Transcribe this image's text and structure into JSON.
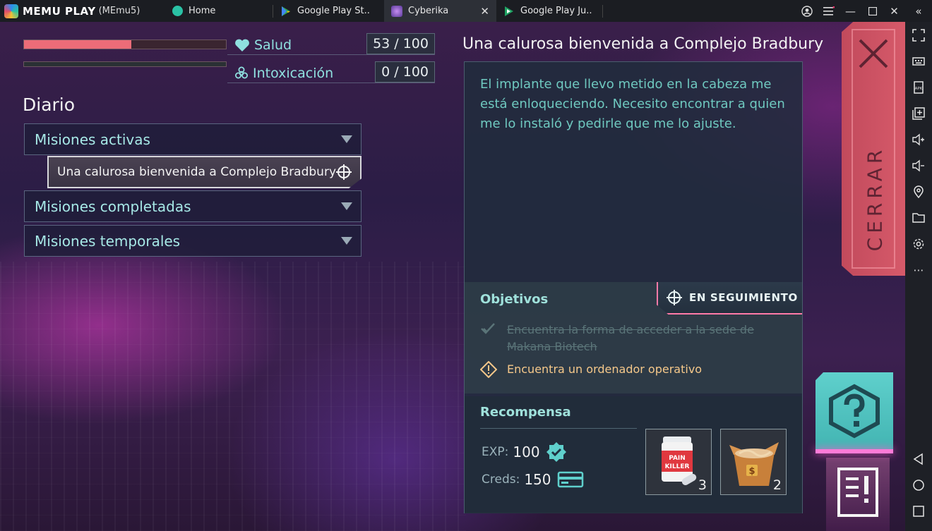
{
  "emulator": {
    "brand": "MEMU PLAY",
    "instance": "(MEmu5)",
    "tabs": [
      {
        "label": "Home",
        "active": false
      },
      {
        "label": "Google Play St..",
        "active": false
      },
      {
        "label": "Cyberika",
        "active": true
      },
      {
        "label": "Google Play Ju..",
        "active": false
      }
    ],
    "sidebar_icons": [
      "fullscreen-icon",
      "keyboard-icon",
      "apk-icon",
      "multi-instance-icon",
      "volume-up-icon",
      "volume-down-icon",
      "location-icon",
      "folder-icon",
      "settings-icon",
      "more-icon",
      "back-icon",
      "home-icon",
      "recents-icon"
    ]
  },
  "status": {
    "health": {
      "label": "Salud",
      "value": "53 / 100",
      "fraction": 0.53
    },
    "intox": {
      "label": "Intoxicación",
      "value": "0 / 100",
      "fraction": 0.0
    }
  },
  "journal": {
    "title": "Diario",
    "sections": [
      {
        "label": "Misiones activas"
      },
      {
        "label": "Misiones completadas"
      },
      {
        "label": "Misiones temporales"
      }
    ],
    "active_quest": "Una calurosa bienvenida a Complejo Bradbury"
  },
  "quest": {
    "title": "Una calurosa bienvenida a Complejo Bradbury",
    "description": "El implante que llevo metido en la cabeza me está enloqueciendo. Necesito encontrar a quien me lo instaló y pedirle que me lo ajuste.",
    "objectives_title": "Objetivos",
    "tracking_label": "EN SEGUIMIENTO",
    "objectives": [
      {
        "text": "Encuentra la forma de acceder a la sede de Makana Biotech",
        "status": "done"
      },
      {
        "text": "Encuentra un ordenador operativo",
        "status": "current"
      }
    ],
    "reward_title": "Recompensa",
    "exp_label": "EXP:",
    "exp_value": "100",
    "creds_label": "Creds:",
    "creds_value": "150",
    "items": [
      {
        "name": "pain-killer",
        "label_top": "PAIN",
        "label_bottom": "KILLER",
        "count": "3"
      },
      {
        "name": "noodle-box",
        "count": "2"
      }
    ]
  },
  "close_label": "CERRAR",
  "colors": {
    "health": "#ec6c78",
    "accent_teal": "#8fe0df",
    "objective_current": "#f5c88a",
    "close_button": "#c94f60",
    "help_button": "#4fc3c0"
  }
}
